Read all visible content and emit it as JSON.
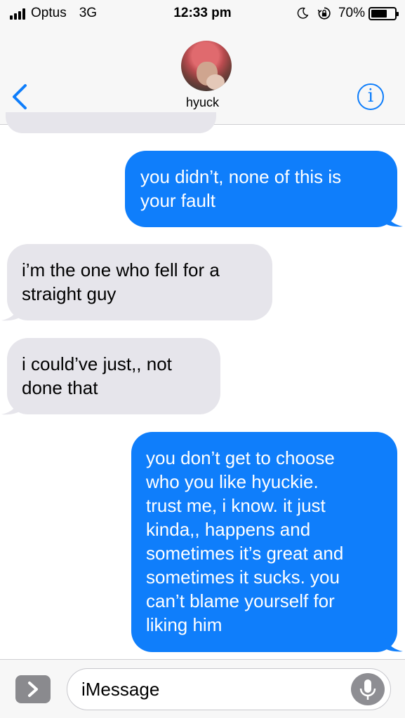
{
  "status_bar": {
    "carrier": "Optus",
    "network": "3G",
    "time": "12:33 pm",
    "battery_text": "70%",
    "battery_level": 0.7,
    "icons": [
      "signal-icon",
      "moon-icon",
      "rotation-lock-icon",
      "battery-icon"
    ]
  },
  "header": {
    "contact_name": "hyuck",
    "back_icon": "chevron-left-icon",
    "info_label": "i",
    "accent": "#0f7efb"
  },
  "messages": [
    {
      "direction": "outgoing",
      "text": "you didn’t, none of this is\nyour fault"
    },
    {
      "direction": "incoming",
      "text": "i’m the one who fell for a\nstraight guy"
    },
    {
      "direction": "incoming",
      "text": "i could’ve just,, not\ndone that"
    },
    {
      "direction": "outgoing",
      "text": "you don’t get to choose\nwho you like hyuckie.\ntrust me, i know. it just\nkinda,, happens and\nsometimes it’s great and\nsometimes it sucks. you\ncan’t blame yourself for\nliking him"
    }
  ],
  "input": {
    "placeholder": "iMessage",
    "apps_icon": "chevron-right-icon",
    "mic_icon": "microphone-icon"
  },
  "colors": {
    "outgoing_bubble": "#0f7efb",
    "incoming_bubble": "#e6e5eb"
  }
}
